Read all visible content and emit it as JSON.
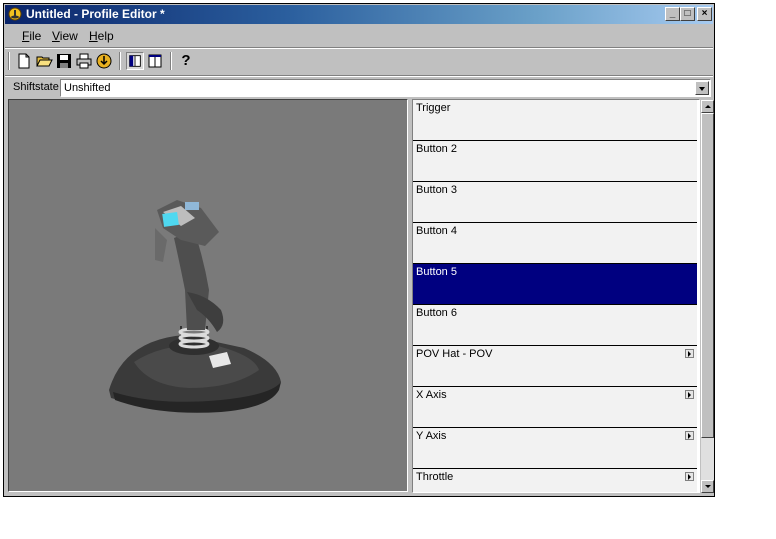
{
  "window": {
    "title": "Untitled - Profile Editor *",
    "controls": {
      "minimize": "_",
      "maximize": "□",
      "close": "×"
    }
  },
  "menu": [
    {
      "label": "File",
      "key": "F",
      "rest": "ile"
    },
    {
      "label": "View",
      "key": "V",
      "rest": "iew"
    },
    {
      "label": "Help",
      "key": "H",
      "rest": "elp"
    }
  ],
  "toolbar": {
    "icons": [
      "new-document-icon",
      "open-folder-icon",
      "save-icon",
      "print-icon",
      "download-profile-icon",
      "split-view-icon",
      "single-view-icon",
      "help-icon"
    ],
    "help_glyph": "?"
  },
  "shiftstate": {
    "label": "Shiftstate",
    "value": "Unshifted"
  },
  "controls_list": [
    {
      "label": "Trigger",
      "selected": false,
      "submenu": false
    },
    {
      "label": "Button 2",
      "selected": false,
      "submenu": false
    },
    {
      "label": "Button 3",
      "selected": false,
      "submenu": false
    },
    {
      "label": "Button 4",
      "selected": false,
      "submenu": false
    },
    {
      "label": "Button 5",
      "selected": true,
      "submenu": false
    },
    {
      "label": "Button 6",
      "selected": false,
      "submenu": false
    },
    {
      "label": "POV Hat - POV",
      "selected": false,
      "submenu": true
    },
    {
      "label": "X Axis",
      "selected": false,
      "submenu": true
    },
    {
      "label": "Y Axis",
      "selected": false,
      "submenu": true
    },
    {
      "label": "Throttle",
      "selected": false,
      "submenu": true
    }
  ],
  "colors": {
    "selection": "#000080",
    "viewport": "#7a7a7a",
    "accent_cyan": "#4fd8f0"
  }
}
